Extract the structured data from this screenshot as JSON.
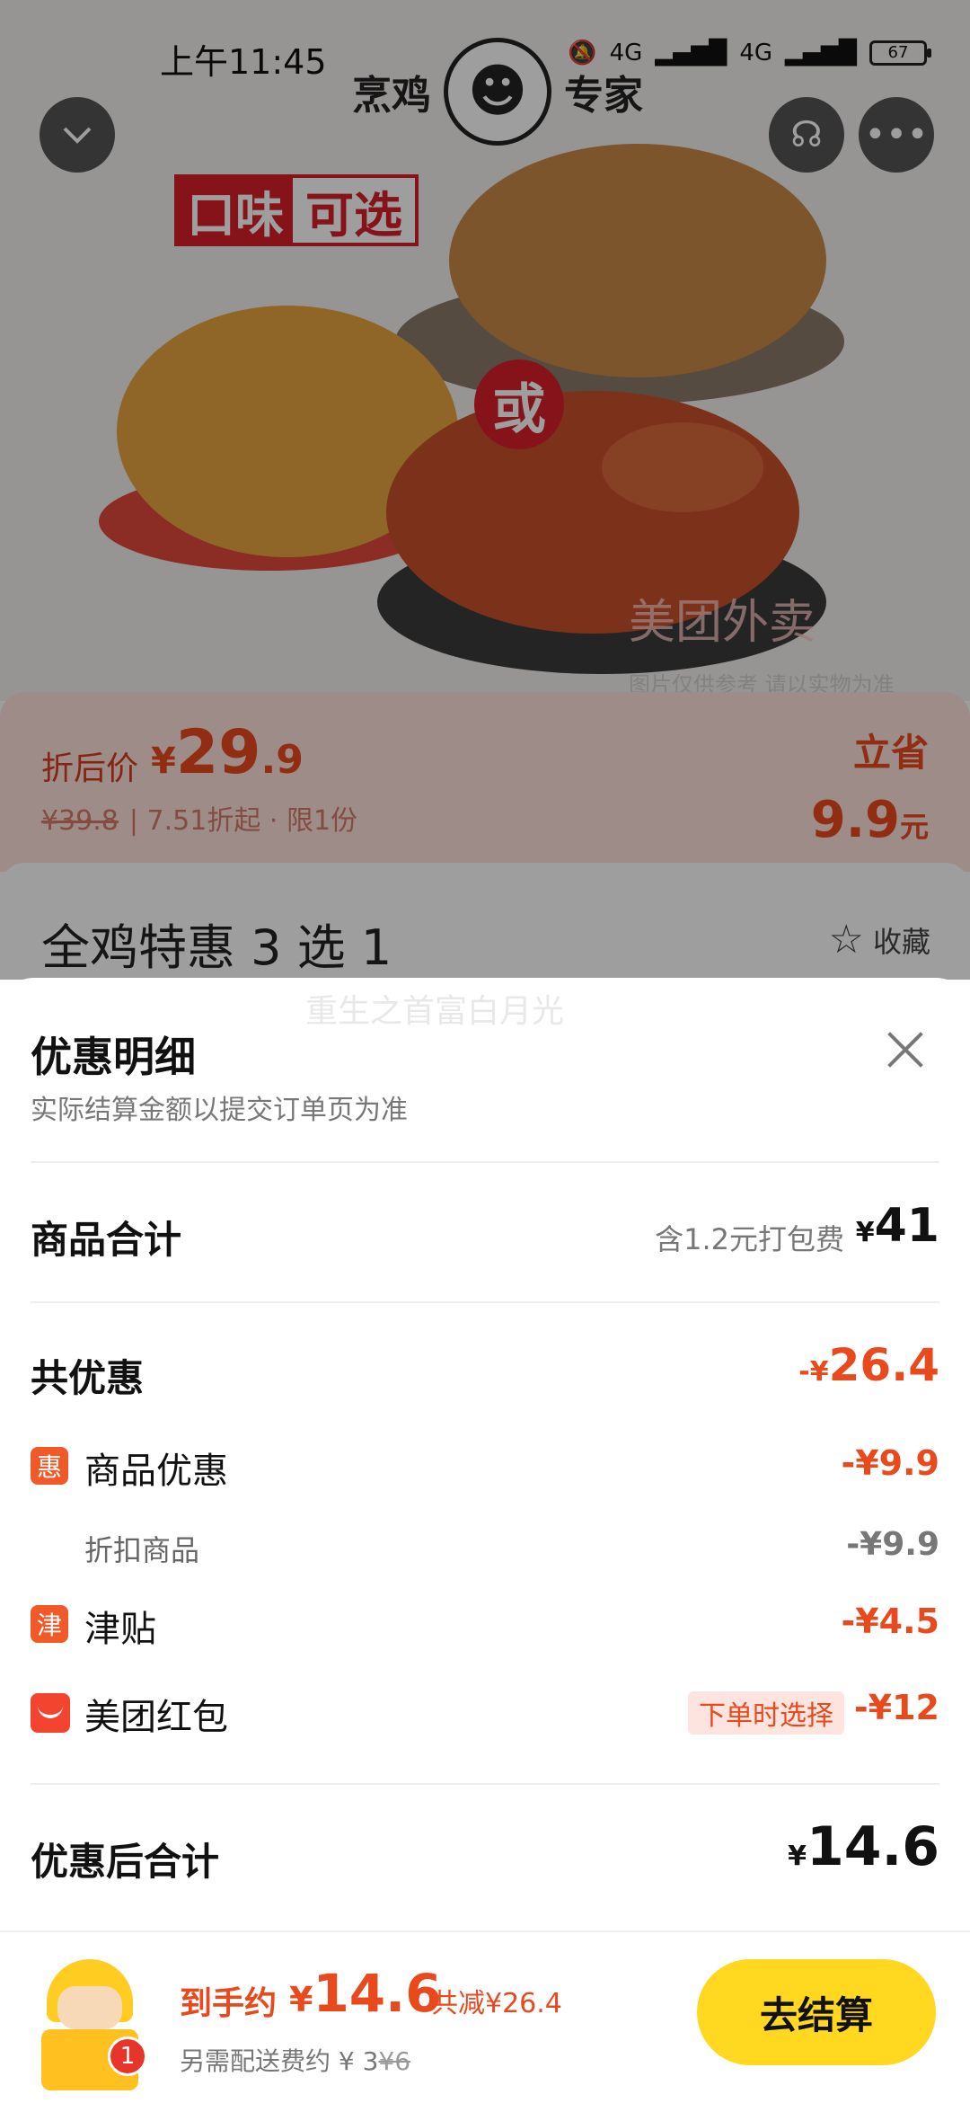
{
  "status_bar": {
    "time": "上午11:45",
    "network": "4G",
    "battery": "67"
  },
  "hero": {
    "brand_left": "烹鸡",
    "brand_right": "专家",
    "promo_badge_a": "口味",
    "promo_badge_b": "可选",
    "or_badge": "或",
    "watermark": "美团外卖",
    "watermark_sub": "图片仅供参考 请以实物为准"
  },
  "price_strip": {
    "label": "折后价",
    "currency": "¥",
    "price_int": "29",
    "price_dec": ".9",
    "original": "¥39.8",
    "discount_info": "| 7.51折起 · 限1份",
    "save_label": "立省",
    "save_value": "9.9",
    "save_unit": "元"
  },
  "product": {
    "title": "全鸡特惠 3 选 1",
    "favorite_label": "收藏",
    "shadow_text": "重生之首富白月光"
  },
  "sheet": {
    "title": "优惠明细",
    "subtitle": "实际结算金额以提交订单页为准",
    "subtotal": {
      "label": "商品合计",
      "note": "含1.2元打包费",
      "currency": "¥",
      "amount": "41"
    },
    "total_discount": {
      "label": "共优惠",
      "prefix": "-¥",
      "amount": "26.4"
    },
    "items": [
      {
        "icon_text": "惠",
        "label": "商品优惠",
        "amount": "-¥9.9"
      },
      {
        "label": "折扣商品",
        "amount": "-¥9.9"
      },
      {
        "icon_text": "津",
        "label": "津贴",
        "amount": "-¥4.5"
      },
      {
        "label": "美团红包",
        "pill": "下单时选择",
        "amount": "-¥12"
      }
    ],
    "final": {
      "label": "优惠后合计",
      "currency": "¥",
      "amount": "14.6"
    }
  },
  "checkout": {
    "badge_count": "1",
    "label": "到手约",
    "currency": "¥",
    "price": "14.6",
    "saved": "共减¥26.4",
    "fee_prefix": "另需配送费约 ¥ 3",
    "fee_original": "¥6",
    "button_label": "去结算"
  },
  "colors": {
    "accent_red": "#e84a1e",
    "checkout_yellow": "#ffd81f"
  }
}
